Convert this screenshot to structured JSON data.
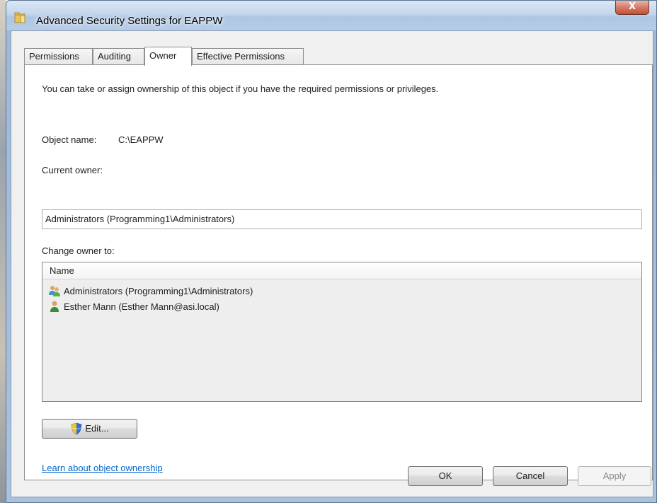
{
  "window": {
    "title": "Advanced Security Settings for EAPPW",
    "close_glyph": "X"
  },
  "tabs": [
    {
      "label": "Permissions"
    },
    {
      "label": "Auditing"
    },
    {
      "label": "Owner",
      "active": true
    },
    {
      "label": "Effective Permissions"
    }
  ],
  "owner_panel": {
    "intro_text": "You can take or assign ownership of this object if you have the required permissions or privileges.",
    "object_name_label": "Object name:",
    "object_name_value": "C:\\EAPPW",
    "current_owner_label": "Current owner:",
    "current_owner_value": "Administrators (Programming1\\Administrators)",
    "change_owner_label": "Change owner to:",
    "list": {
      "column_header": "Name",
      "items": [
        {
          "label": "Administrators (Programming1\\Administrators)",
          "icon": "group-icon"
        },
        {
          "label": "Esther Mann (Esther Mann@asi.local)",
          "icon": "user-icon"
        }
      ]
    },
    "edit_button": "Edit...",
    "learn_link": "Learn about object ownership"
  },
  "buttons": {
    "ok": "OK",
    "cancel": "Cancel",
    "apply": "Apply"
  },
  "colors": {
    "link": "#0066cc",
    "panel_bg": "#ffffff",
    "dialog_bg": "#f0f0f0"
  }
}
